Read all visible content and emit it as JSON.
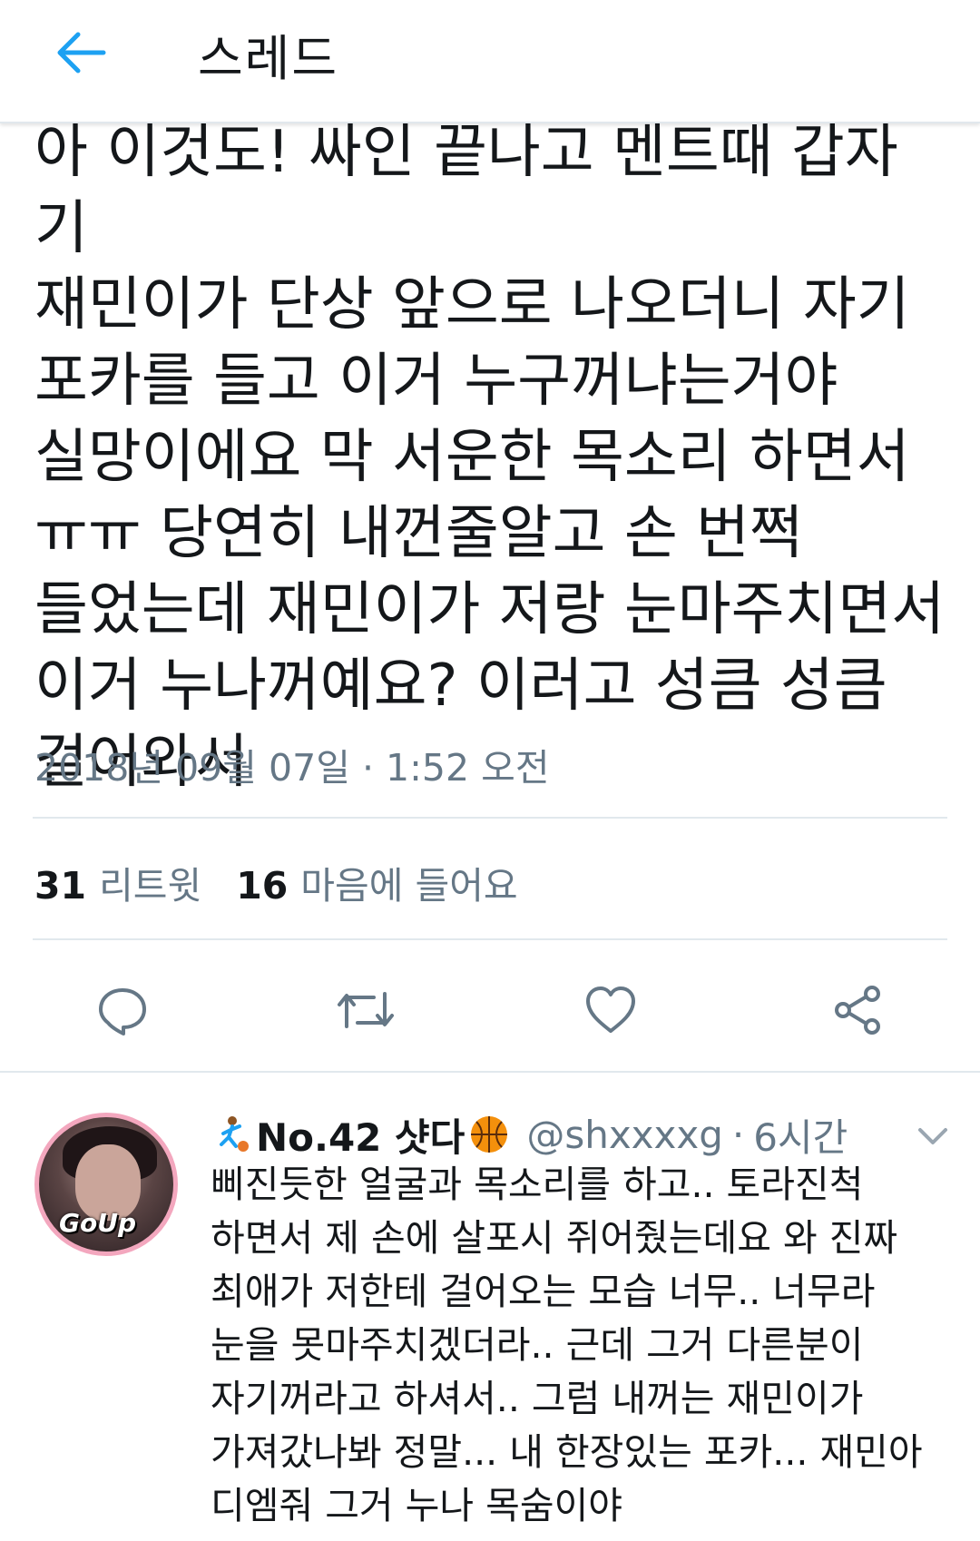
{
  "header": {
    "title": "스레드",
    "back_icon": "arrow-left-icon",
    "accent_color": "#1da1f2"
  },
  "tweet": {
    "text": "아 이것도! 싸인 끝나고 멘트때 갑자기\n재민이가 단상 앞으로 나오더니 자기\n포카를 들고 이거 누구꺼냐는거야\n실망이에요 막 서운한 목소리 하면서\nㅠㅠ 당연히 내껀줄알고 손 번쩍\n들었는데 재민이가 저랑 눈마주치면서\n이거 누나꺼예요? 이러고 성큼 성큼\n걸어와서",
    "timestamp": "2018년 09월 07일 · 1:52 오전",
    "stats": {
      "retweets_count": "31",
      "retweets_label": "리트윗",
      "likes_count": "16",
      "likes_label": "마음에 들어요"
    },
    "actions": {
      "reply_icon": "reply-bubble-icon",
      "retweet_icon": "retweet-icon",
      "like_icon": "heart-icon",
      "share_icon": "share-icon"
    }
  },
  "reply": {
    "display_name": "No.42 샷다",
    "handle": "@shxxxxg",
    "separator": "·",
    "age": "6시간",
    "avatar_badge": "GoUp",
    "emoji_left": "basketball-player-icon",
    "emoji_right": "basketball-icon",
    "text": "삐진듯한 얼굴과 목소리를 하고.. 토라진척\n하면서 제 손에 살포시 쥐어줬는데요 와 진짜\n최애가 저한테 걸어오는 모습 너무.. 너무라\n눈을 못마주치겠더라.. 근데 그거 다른분이\n자기꺼라고 하셔서.. 그럼 내꺼는 재민이가\n가져갔나봐 정말... 내 한장있는 포카... 재민아\n디엠줘 그거 누나 목숨이야"
  }
}
